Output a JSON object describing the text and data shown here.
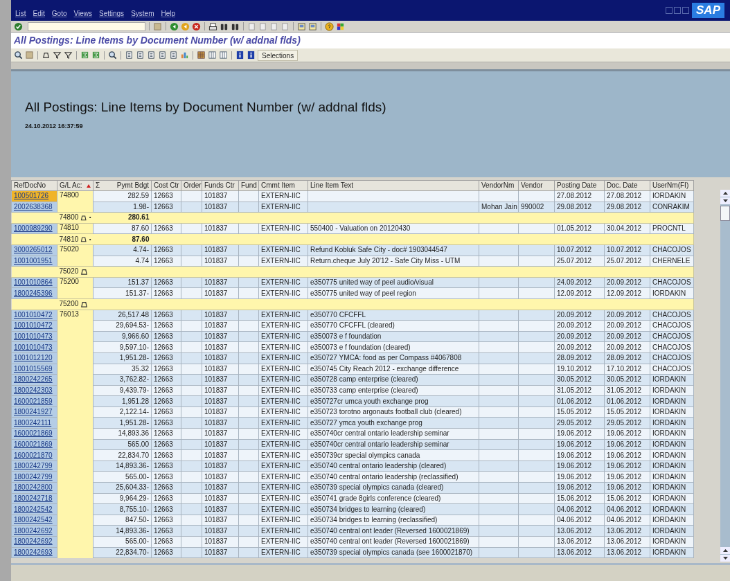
{
  "menu": [
    "List",
    "Edit",
    "Goto",
    "Views",
    "Settings",
    "System",
    "Help"
  ],
  "logo": "SAP",
  "screen_title": "All Postings: Line Items by Document Number (w/ addnal flds)",
  "app_toolbar": {
    "button": "Selections"
  },
  "list_header": {
    "title": "All Postings: Line Items by Document Number (w/ addnal flds)",
    "timestamp": "24.10.2012 16:37:59"
  },
  "table": {
    "columns": [
      "RefDocNo",
      "G/L Ac:",
      "Pymt Bdgt",
      "Cost Ctr",
      "Order",
      "Funds Ctr",
      "Fund",
      "Cmmt Item",
      "Line Item Text",
      "VendorNm",
      "Vendor",
      "Posting Date",
      "Doc. Date",
      "UserNm(FI)"
    ],
    "sum_marker": "Σ",
    "rows": [
      {
        "kind": "item",
        "selected": true,
        "ref_doc": "100501726",
        "gl_account": "74800",
        "amount": "282.59",
        "cost_ctr": "12663",
        "funds_ctr": "101837",
        "cmmt_item": "EXTERN-IIC",
        "posting_date": "27.08.2012",
        "doc_date": "27.08.2012",
        "user": "IORDAKIN"
      },
      {
        "kind": "item",
        "selected": false,
        "ref_doc": "2002638368",
        "amount": "1.98-",
        "cost_ctr": "12663",
        "funds_ctr": "101837",
        "cmmt_item": "EXTERN-IIC",
        "vendor_name": "Mohan Jain",
        "vendor": "990002",
        "posting_date": "29.08.2012",
        "doc_date": "29.08.2012",
        "user": "CONRAKIM"
      },
      {
        "kind": "subtotal",
        "gl_account": "74800",
        "marker": "•",
        "amount": "280.61"
      },
      {
        "kind": "item",
        "selected": false,
        "ref_doc": "1000989290",
        "gl_account": "74810",
        "amount": "87.60",
        "cost_ctr": "12663",
        "funds_ctr": "101837",
        "cmmt_item": "EXTERN-IIC",
        "text": "550400 - Valuation on 20120430",
        "posting_date": "01.05.2012",
        "doc_date": "30.04.2012",
        "user": "PROCNTL"
      },
      {
        "kind": "subtotal",
        "gl_account": "74810",
        "marker": "•",
        "amount": "87.60"
      },
      {
        "kind": "item",
        "selected": false,
        "ref_doc": "3000265012",
        "gl_account": "75020",
        "amount": "4.74-",
        "cost_ctr": "12663",
        "funds_ctr": "101837",
        "cmmt_item": "EXTERN-IIC",
        "text": "Refund Kobluk Safe City - doc# 1903044547",
        "posting_date": "10.07.2012",
        "doc_date": "10.07.2012",
        "user": "CHACOJOS"
      },
      {
        "kind": "item",
        "selected": false,
        "ref_doc": "1001001951",
        "amount": "4.74",
        "cost_ctr": "12663",
        "funds_ctr": "101837",
        "cmmt_item": "EXTERN-IIC",
        "text": "Return.cheque July 20'12 - Safe City Miss - UTM",
        "posting_date": "25.07.2012",
        "doc_date": "25.07.2012",
        "user": "CHERNELE"
      },
      {
        "kind": "subtotal",
        "gl_account": "75020"
      },
      {
        "kind": "item",
        "selected": false,
        "ref_doc": "1001010864",
        "gl_account": "75200",
        "amount": "151.37",
        "cost_ctr": "12663",
        "funds_ctr": "101837",
        "cmmt_item": "EXTERN-IIC",
        "text": "e350775 united way of peel audio/visual",
        "posting_date": "24.09.2012",
        "doc_date": "20.09.2012",
        "user": "CHACOJOS"
      },
      {
        "kind": "item",
        "selected": false,
        "ref_doc": "1800245396",
        "amount": "151.37-",
        "cost_ctr": "12663",
        "funds_ctr": "101837",
        "cmmt_item": "EXTERN-IIC",
        "text": "e350775 united way of peel region",
        "posting_date": "12.09.2012",
        "doc_date": "12.09.2012",
        "user": "IORDAKIN"
      },
      {
        "kind": "subtotal",
        "gl_account": "75200"
      },
      {
        "kind": "item",
        "selected": false,
        "ref_doc": "1001010472",
        "gl_account": "76013",
        "amount": "26,517.48",
        "cost_ctr": "12663",
        "funds_ctr": "101837",
        "cmmt_item": "EXTERN-IIC",
        "text": "e350770 CFCFFL",
        "posting_date": "20.09.2012",
        "doc_date": "20.09.2012",
        "user": "CHACOJOS"
      },
      {
        "kind": "item",
        "selected": false,
        "ref_doc": "1001010472",
        "amount": "29,694.53-",
        "cost_ctr": "12663",
        "funds_ctr": "101837",
        "cmmt_item": "EXTERN-IIC",
        "text": "e350770 CFCFFL (cleared)",
        "posting_date": "20.09.2012",
        "doc_date": "20.09.2012",
        "user": "CHACOJOS"
      },
      {
        "kind": "item",
        "selected": false,
        "ref_doc": "1001010473",
        "amount": "9,966.60",
        "cost_ctr": "12663",
        "funds_ctr": "101837",
        "cmmt_item": "EXTERN-IIC",
        "text": "e350073 e f foundation",
        "posting_date": "20.09.2012",
        "doc_date": "20.09.2012",
        "user": "CHACOJOS"
      },
      {
        "kind": "item",
        "selected": false,
        "ref_doc": "1001010473",
        "amount": "9,597.10-",
        "cost_ctr": "12663",
        "funds_ctr": "101837",
        "cmmt_item": "EXTERN-IIC",
        "text": "e350073 e f foundation (cleared)",
        "posting_date": "20.09.2012",
        "doc_date": "20.09.2012",
        "user": "CHACOJOS"
      },
      {
        "kind": "item",
        "selected": false,
        "ref_doc": "1001012120",
        "amount": "1,951.28-",
        "cost_ctr": "12663",
        "funds_ctr": "101837",
        "cmmt_item": "EXTERN-IIC",
        "text": "e350727 YMCA: food as per Compass #4067808",
        "posting_date": "28.09.2012",
        "doc_date": "28.09.2012",
        "user": "CHACOJOS"
      },
      {
        "kind": "item",
        "selected": false,
        "ref_doc": "1001015569",
        "amount": "35.32",
        "cost_ctr": "12663",
        "funds_ctr": "101837",
        "cmmt_item": "EXTERN-IIC",
        "text": "e350745 City Reach 2012 - exchange difference",
        "posting_date": "19.10.2012",
        "doc_date": "17.10.2012",
        "user": "CHACOJOS"
      },
      {
        "kind": "item",
        "selected": false,
        "ref_doc": "1800242265",
        "amount": "3,762.82-",
        "cost_ctr": "12663",
        "funds_ctr": "101837",
        "cmmt_item": "EXTERN-IIC",
        "text": "e350728 camp enterprise (cleared)",
        "posting_date": "30.05.2012",
        "doc_date": "30.05.2012",
        "user": "IORDAKIN"
      },
      {
        "kind": "item",
        "selected": false,
        "ref_doc": "1800242303",
        "amount": "9,439.79-",
        "cost_ctr": "12663",
        "funds_ctr": "101837",
        "cmmt_item": "EXTERN-IIC",
        "text": "e350733 camp enterprise (cleared)",
        "posting_date": "31.05.2012",
        "doc_date": "31.05.2012",
        "user": "IORDAKIN"
      },
      {
        "kind": "item",
        "selected": false,
        "ref_doc": "1600021859",
        "amount": "1,951.28",
        "cost_ctr": "12663",
        "funds_ctr": "101837",
        "cmmt_item": "EXTERN-IIC",
        "text": "e350727cr umca youth exchange prog",
        "posting_date": "01.06.2012",
        "doc_date": "01.06.2012",
        "user": "IORDAKIN"
      },
      {
        "kind": "item",
        "selected": false,
        "ref_doc": "1800241927",
        "amount": "2,122.14-",
        "cost_ctr": "12663",
        "funds_ctr": "101837",
        "cmmt_item": "EXTERN-IIC",
        "text": "e350723 torotno argonauts football club (cleared)",
        "posting_date": "15.05.2012",
        "doc_date": "15.05.2012",
        "user": "IORDAKIN"
      },
      {
        "kind": "item",
        "selected": false,
        "ref_doc": "1800242111",
        "amount": "1,951.28-",
        "cost_ctr": "12663",
        "funds_ctr": "101837",
        "cmmt_item": "EXTERN-IIC",
        "text": "e350727 ymca youth exchange prog",
        "posting_date": "29.05.2012",
        "doc_date": "29.05.2012",
        "user": "IORDAKIN"
      },
      {
        "kind": "item",
        "selected": false,
        "ref_doc": "1600021869",
        "amount": "14,893.36",
        "cost_ctr": "12663",
        "funds_ctr": "101837",
        "cmmt_item": "EXTERN-IIC",
        "text": "e350740cr central ontario leadership seminar",
        "posting_date": "19.06.2012",
        "doc_date": "19.06.2012",
        "user": "IORDAKIN"
      },
      {
        "kind": "item",
        "selected": false,
        "ref_doc": "1600021869",
        "amount": "565.00",
        "cost_ctr": "12663",
        "funds_ctr": "101837",
        "cmmt_item": "EXTERN-IIC",
        "text": "e350740cr central ontario leadership seminar",
        "posting_date": "19.06.2012",
        "doc_date": "19.06.2012",
        "user": "IORDAKIN"
      },
      {
        "kind": "item",
        "selected": false,
        "ref_doc": "1600021870",
        "amount": "22,834.70",
        "cost_ctr": "12663",
        "funds_ctr": "101837",
        "cmmt_item": "EXTERN-IIC",
        "text": "e350739cr special olympics canada",
        "posting_date": "19.06.2012",
        "doc_date": "19.06.2012",
        "user": "IORDAKIN"
      },
      {
        "kind": "item",
        "selected": false,
        "ref_doc": "1800242799",
        "amount": "14,893.36-",
        "cost_ctr": "12663",
        "funds_ctr": "101837",
        "cmmt_item": "EXTERN-IIC",
        "text": "e350740 central ontario leadership (cleared)",
        "posting_date": "19.06.2012",
        "doc_date": "19.06.2012",
        "user": "IORDAKIN"
      },
      {
        "kind": "item",
        "selected": false,
        "ref_doc": "1800242799",
        "amount": "565.00-",
        "cost_ctr": "12663",
        "funds_ctr": "101837",
        "cmmt_item": "EXTERN-IIC",
        "text": "e350740 central ontario leadership (reclassified)",
        "posting_date": "19.06.2012",
        "doc_date": "19.06.2012",
        "user": "IORDAKIN"
      },
      {
        "kind": "item",
        "selected": false,
        "ref_doc": "1800242800",
        "amount": "25,604.33-",
        "cost_ctr": "12663",
        "funds_ctr": "101837",
        "cmmt_item": "EXTERN-IIC",
        "text": "e350739 special olympics canada (cleared)",
        "posting_date": "19.06.2012",
        "doc_date": "19.06.2012",
        "user": "IORDAKIN"
      },
      {
        "kind": "item",
        "selected": false,
        "ref_doc": "1800242718",
        "amount": "9,964.29-",
        "cost_ctr": "12663",
        "funds_ctr": "101837",
        "cmmt_item": "EXTERN-IIC",
        "text": "e350741 grade 8girls conference (cleared)",
        "posting_date": "15.06.2012",
        "doc_date": "15.06.2012",
        "user": "IORDAKIN"
      },
      {
        "kind": "item",
        "selected": false,
        "ref_doc": "1800242542",
        "amount": "8,755.10-",
        "cost_ctr": "12663",
        "funds_ctr": "101837",
        "cmmt_item": "EXTERN-IIC",
        "text": "e350734 bridges to learning (cleared)",
        "posting_date": "04.06.2012",
        "doc_date": "04.06.2012",
        "user": "IORDAKIN"
      },
      {
        "kind": "item",
        "selected": false,
        "ref_doc": "1800242542",
        "amount": "847.50-",
        "cost_ctr": "12663",
        "funds_ctr": "101837",
        "cmmt_item": "EXTERN-IIC",
        "text": "e350734 bridges to learning (reclassified)",
        "posting_date": "04.06.2012",
        "doc_date": "04.06.2012",
        "user": "IORDAKIN"
      },
      {
        "kind": "item",
        "selected": false,
        "ref_doc": "1800242692",
        "amount": "14,893.36-",
        "cost_ctr": "12663",
        "funds_ctr": "101837",
        "cmmt_item": "EXTERN-IIC",
        "text": "e350740 central ont leader (Reversed 1600021869)",
        "posting_date": "13.06.2012",
        "doc_date": "13.06.2012",
        "user": "IORDAKIN"
      },
      {
        "kind": "item",
        "selected": false,
        "ref_doc": "1800242692",
        "amount": "565.00-",
        "cost_ctr": "12663",
        "funds_ctr": "101837",
        "cmmt_item": "EXTERN-IIC",
        "text": "e350740 central ont leader (Reversed 1600021869)",
        "posting_date": "13.06.2012",
        "doc_date": "13.06.2012",
        "user": "IORDAKIN"
      },
      {
        "kind": "item",
        "selected": false,
        "ref_doc": "1800242693",
        "amount": "22,834.70-",
        "cost_ctr": "12663",
        "funds_ctr": "101837",
        "cmmt_item": "EXTERN-IIC",
        "text": "e350739 special olympics canada (see 1600021870)",
        "posting_date": "13.06.2012",
        "doc_date": "13.06.2012",
        "user": "IORDAKIN"
      }
    ]
  }
}
